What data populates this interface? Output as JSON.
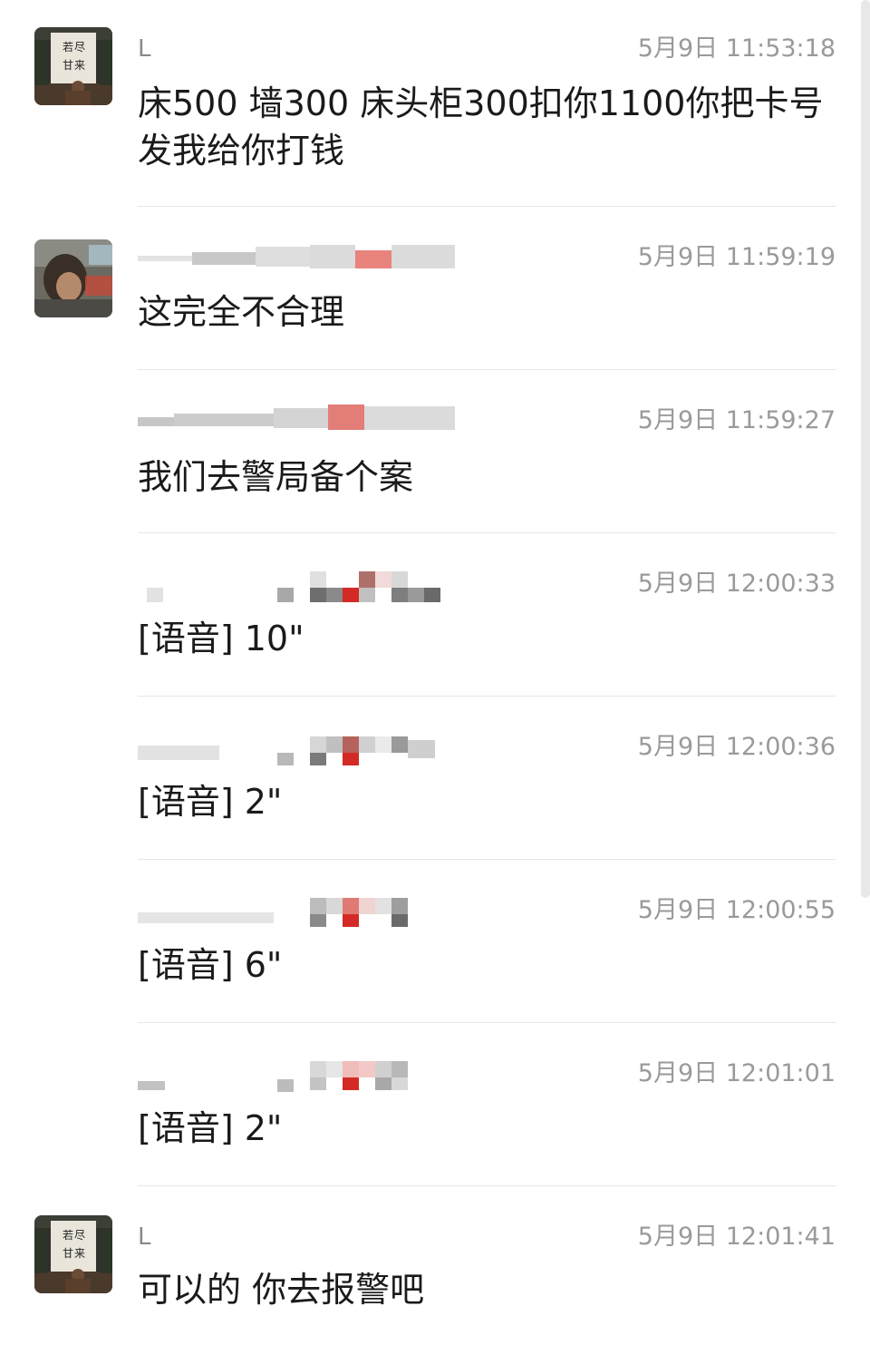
{
  "messages": [
    {
      "sender": "L",
      "time": "5月9日 11:53:18",
      "text": "床500 墙300 床头柜300扣你1100你把卡号发我给你打钱",
      "avatar": "calligraphy-avatar",
      "sender_blurred": false
    },
    {
      "sender": "",
      "time": "5月9日 11:59:19",
      "text": "这完全不合理",
      "avatar": "photo-avatar-blurred",
      "sender_blurred": true
    },
    {
      "sender": "",
      "time": "5月9日 11:59:27",
      "text": "我们去警局备个案",
      "avatar": null,
      "sender_blurred": true
    },
    {
      "sender": "",
      "time": "5月9日 12:00:33",
      "text": "[语音] 10\"",
      "avatar": null,
      "sender_blurred": true
    },
    {
      "sender": "",
      "time": "5月9日 12:00:36",
      "text": "[语音] 2\"",
      "avatar": null,
      "sender_blurred": true
    },
    {
      "sender": "",
      "time": "5月9日 12:00:55",
      "text": "[语音] 6\"",
      "avatar": null,
      "sender_blurred": true
    },
    {
      "sender": "",
      "time": "5月9日 12:01:01",
      "text": "[语音] 2\"",
      "avatar": null,
      "sender_blurred": true
    },
    {
      "sender": "L",
      "time": "5月9日 12:01:41",
      "text": "可以的 你去报警吧",
      "avatar": "calligraphy-avatar",
      "sender_blurred": false
    }
  ],
  "colors": {
    "text": "#1a1a1a",
    "meta": "#9a9a9a",
    "divider": "#e6e6e6",
    "redaction_red": "#d9302f"
  }
}
